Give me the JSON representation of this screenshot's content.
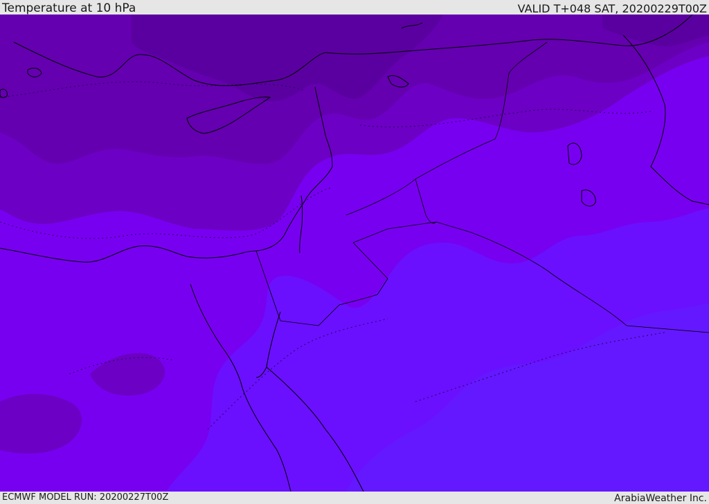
{
  "header": {
    "title": "Temperature at 10 hPa",
    "valid": "VALID T+048 SAT, 20200229T00Z"
  },
  "footer": {
    "model_run": "ECMWF MODEL RUN: 20200227T00Z",
    "credit": "ArabiaWeather Inc."
  },
  "map": {
    "field": "temperature",
    "level": "10 hPa",
    "colors": {
      "band_1": "#5a00a0",
      "band_2": "#6a00b8",
      "band_3": "#7400d0",
      "band_4": "#7800f0",
      "band_5": "#6a10ff",
      "coastline": "#000000",
      "border": "#000000"
    }
  }
}
